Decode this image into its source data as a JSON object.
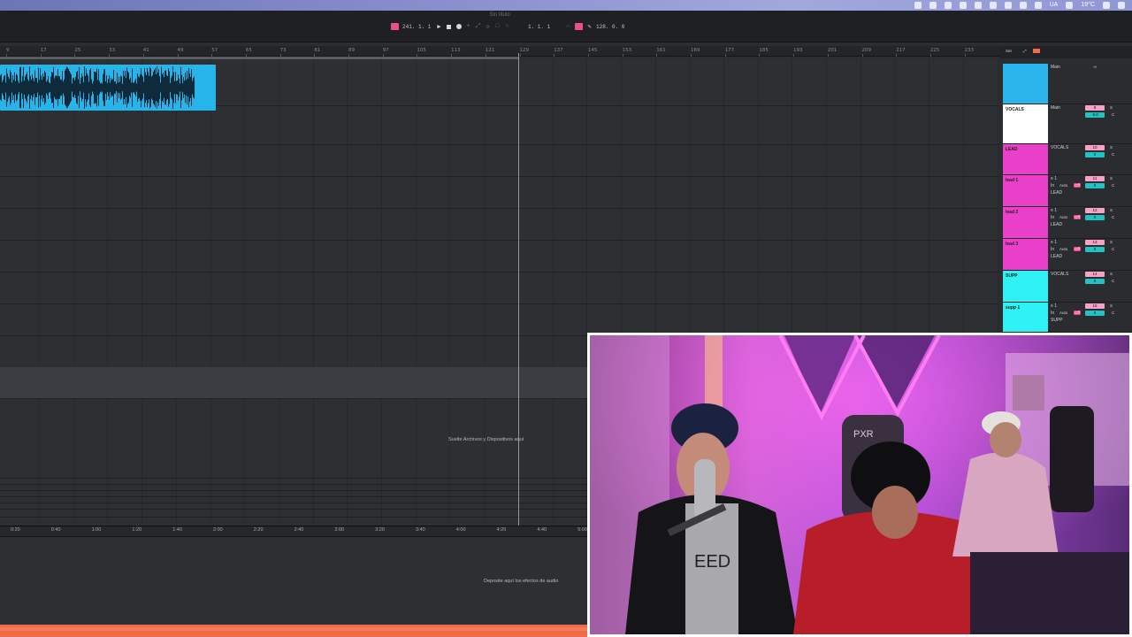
{
  "menubar": {
    "keyboard_layout": "UA",
    "temperature": "19°C"
  },
  "transport": {
    "song_title": "Sin título",
    "tempo": "241.   1.   1",
    "position": "1.   1.   1",
    "bpm": "128.   0.   0"
  },
  "ruler": {
    "labels": [
      "9",
      "17",
      "25",
      "33",
      "41",
      "49",
      "57",
      "65",
      "73",
      "81",
      "89",
      "97",
      "105",
      "113",
      "121",
      "129",
      "137",
      "145",
      "153",
      "161",
      "169",
      "177",
      "185",
      "193",
      "201",
      "209",
      "217",
      "225",
      "233"
    ]
  },
  "arrangement": {
    "drop_files_hint": "Suelte Archivos y Dispositivos aquí"
  },
  "time_ruler": {
    "labels": [
      "0:20",
      "0:40",
      "1:00",
      "1:20",
      "1:40",
      "2:00",
      "2:20",
      "2:40",
      "3:00",
      "3:20",
      "3:40",
      "4:00",
      "4:20",
      "4:40",
      "5:00"
    ]
  },
  "device_area": {
    "drop_effects_hint": "Deposite aquí los efectos de audio"
  },
  "mixer": {
    "header_set": "Set",
    "rows": [
      {
        "name": "",
        "color": "#2ab5ec",
        "route": "Main",
        "track_no": "",
        "no_color": "",
        "volume": "-∞",
        "pan": ""
      },
      {
        "name": "VOCALS",
        "color": "#ffffff",
        "route": "Main",
        "track_no": "9",
        "no_color": "#f7a1c5",
        "volume": "-6.0",
        "pan": "C"
      },
      {
        "name": "LEAD",
        "color": "#e93fc9",
        "route": "VOCALS",
        "track_no": "10",
        "no_color": "#f7a1c5",
        "volume": "0",
        "pan": "C"
      },
      {
        "name": "lead 1",
        "color": "#e93fc9",
        "route": "LEAD",
        "track_no": "11",
        "no_color": "#f7a1c5",
        "volume": "0",
        "pan": "C",
        "input": "≡ 1",
        "mode_in": "In",
        "mode_auto": "Auto",
        "mode_off": "Off"
      },
      {
        "name": "lead 2",
        "color": "#e93fc9",
        "route": "LEAD",
        "track_no": "12",
        "no_color": "#f7a1c5",
        "volume": "0",
        "pan": "C",
        "input": "≡ 1",
        "mode_in": "In",
        "mode_auto": "Auto",
        "mode_off": "Off"
      },
      {
        "name": "lead 3",
        "color": "#e93fc9",
        "route": "LEAD",
        "track_no": "13",
        "no_color": "#f7a1c5",
        "volume": "0",
        "pan": "C",
        "input": "≡ 1",
        "mode_in": "In",
        "mode_auto": "Auto",
        "mode_off": "Off"
      },
      {
        "name": "SUPP",
        "color": "#2ff2f4",
        "route": "VOCALS",
        "track_no": "14",
        "no_color": "#f7a1c5",
        "volume": "0",
        "pan": "C"
      },
      {
        "name": "supp 1",
        "color": "#2ff2f4",
        "route": "SUPP",
        "track_no": "15",
        "no_color": "#f7a1c5",
        "volume": "0",
        "pan": "C",
        "input": "≡ 1",
        "mode_in": "In",
        "mode_auto": "Auto",
        "mode_off": "Off"
      }
    ]
  },
  "webcam": {
    "chair_brand": "PXR"
  },
  "colors": {
    "clip": "#26b4ea",
    "status_bar": "#f06b48",
    "arm": "#ee4d8c"
  }
}
